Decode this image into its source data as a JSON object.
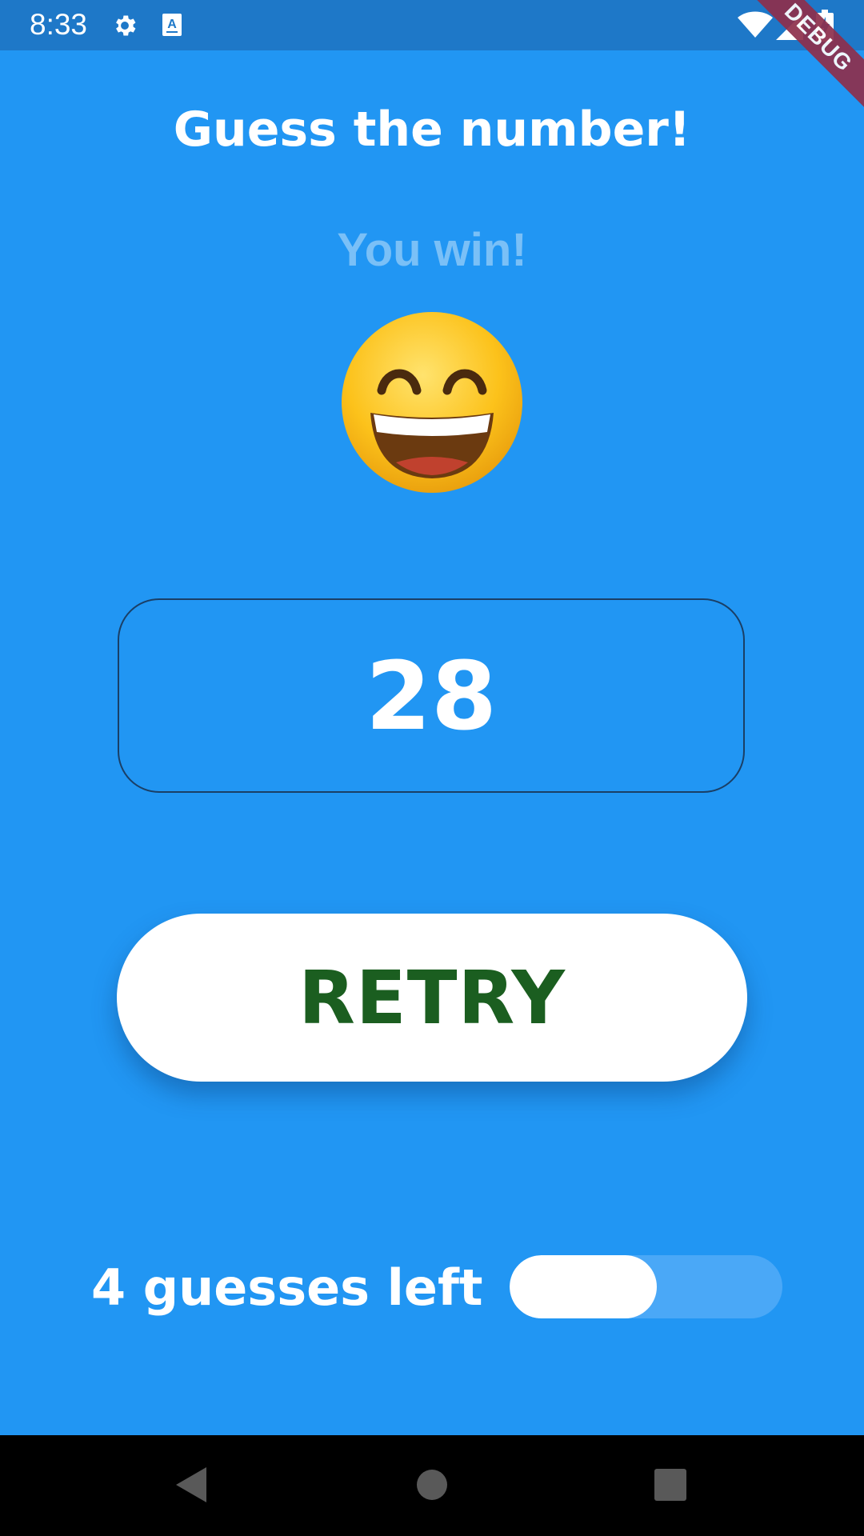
{
  "status_bar": {
    "time": "8:33",
    "icons": [
      "settings-icon",
      "keyboard-a-icon",
      "wifi-icon",
      "cellular-signal-icon",
      "battery-charging-icon"
    ]
  },
  "debug_banner": "DEBUG",
  "title": "Guess the number!",
  "result_text": "You win!",
  "result_emoji": "grinning-face-with-smiling-eyes",
  "guess_input": {
    "value": "28"
  },
  "retry_button": {
    "label": "RETRY"
  },
  "guesses": {
    "label": "4 guesses left",
    "remaining_fraction": 0.54
  },
  "colors": {
    "background": "#2196F3",
    "status_bar": "#1E78C8",
    "button_text": "#1B5E20",
    "debug_banner": "#8E2F4C"
  },
  "nav_bar": {
    "buttons": [
      "back-icon",
      "home-icon",
      "recents-icon"
    ]
  }
}
